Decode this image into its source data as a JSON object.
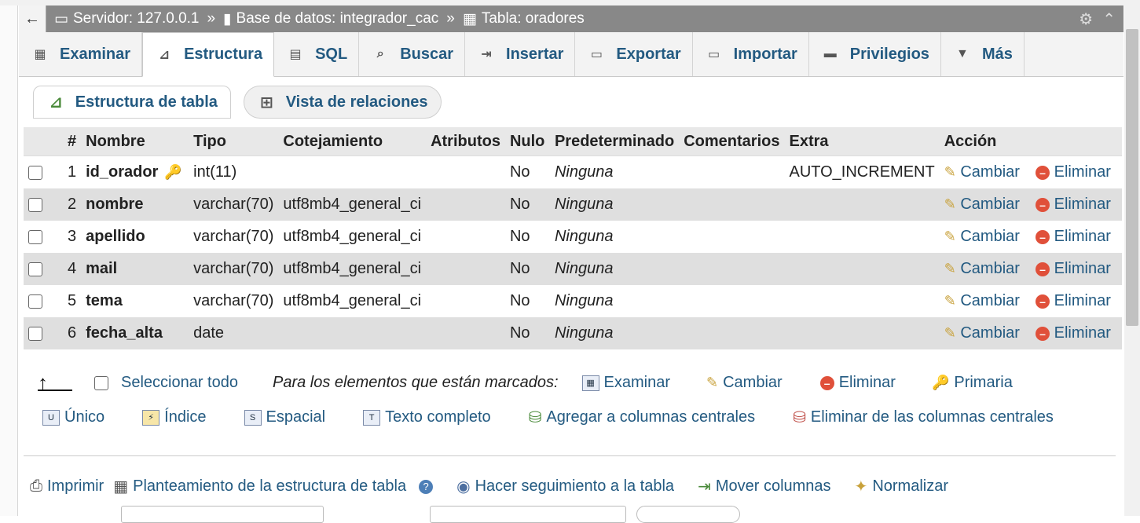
{
  "breadcrumb": {
    "back": "←",
    "server": "Servidor: 127.0.0.1",
    "database": "Base de datos: integrador_cac",
    "table": "Tabla: oradores",
    "separator": "»"
  },
  "tabs": [
    {
      "label": "Examinar",
      "icon": "▦"
    },
    {
      "label": "Estructura",
      "icon": "⊿",
      "active": true
    },
    {
      "label": "SQL",
      "icon": "▤"
    },
    {
      "label": "Buscar",
      "icon": "⌕"
    },
    {
      "label": "Insertar",
      "icon": "⇥"
    },
    {
      "label": "Exportar",
      "icon": "▭"
    },
    {
      "label": "Importar",
      "icon": "▭"
    },
    {
      "label": "Privilegios",
      "icon": "▬"
    },
    {
      "label": "Más",
      "icon": "▼"
    }
  ],
  "subtabs": {
    "structure": "Estructura de tabla",
    "relations": "Vista de relaciones"
  },
  "table": {
    "headers": [
      "#",
      "Nombre",
      "Tipo",
      "Cotejamiento",
      "Atributos",
      "Nulo",
      "Predeterminado",
      "Comentarios",
      "Extra",
      "Acción"
    ],
    "rows": [
      {
        "num": "1",
        "name": "id_orador",
        "type": "int(11)",
        "collation": "",
        "attributes": "",
        "null": "No",
        "default": "Ninguna",
        "comments": "",
        "extra": "AUTO_INCREMENT",
        "primary": true
      },
      {
        "num": "2",
        "name": "nombre",
        "type": "varchar(70)",
        "collation": "utf8mb4_general_ci",
        "attributes": "",
        "null": "No",
        "default": "Ninguna",
        "comments": "",
        "extra": ""
      },
      {
        "num": "3",
        "name": "apellido",
        "type": "varchar(70)",
        "collation": "utf8mb4_general_ci",
        "attributes": "",
        "null": "No",
        "default": "Ninguna",
        "comments": "",
        "extra": ""
      },
      {
        "num": "4",
        "name": "mail",
        "type": "varchar(70)",
        "collation": "utf8mb4_general_ci",
        "attributes": "",
        "null": "No",
        "default": "Ninguna",
        "comments": "",
        "extra": ""
      },
      {
        "num": "5",
        "name": "tema",
        "type": "varchar(70)",
        "collation": "utf8mb4_general_ci",
        "attributes": "",
        "null": "No",
        "default": "Ninguna",
        "comments": "",
        "extra": ""
      },
      {
        "num": "6",
        "name": "fecha_alta",
        "type": "date",
        "collation": "",
        "attributes": "",
        "null": "No",
        "default": "Ninguna",
        "comments": "",
        "extra": ""
      }
    ],
    "action_change": "Cambiar",
    "action_delete": "Eliminar"
  },
  "bulk": {
    "select_all": "Seleccionar todo",
    "with_selected": "Para los elementos que están marcados:",
    "browse": "Examinar",
    "change": "Cambiar",
    "delete": "Eliminar",
    "primary": "Primaria",
    "unique": "Único",
    "index": "Índice",
    "spatial": "Espacial",
    "fulltext": "Texto completo",
    "add_central": "Agregar a columnas centrales",
    "remove_central": "Eliminar de las columnas centrales"
  },
  "bottom": {
    "print": "Imprimir",
    "propose": "Planteamiento de la estructura de tabla",
    "track": "Hacer seguimiento a la tabla",
    "move": "Mover columnas",
    "normalize": "Normalizar"
  },
  "colors": {
    "link": "#235a81",
    "breadcrumb_bg": "#888888",
    "row_alt": "#dfdfdf",
    "header_bg": "#e8e8e8"
  }
}
